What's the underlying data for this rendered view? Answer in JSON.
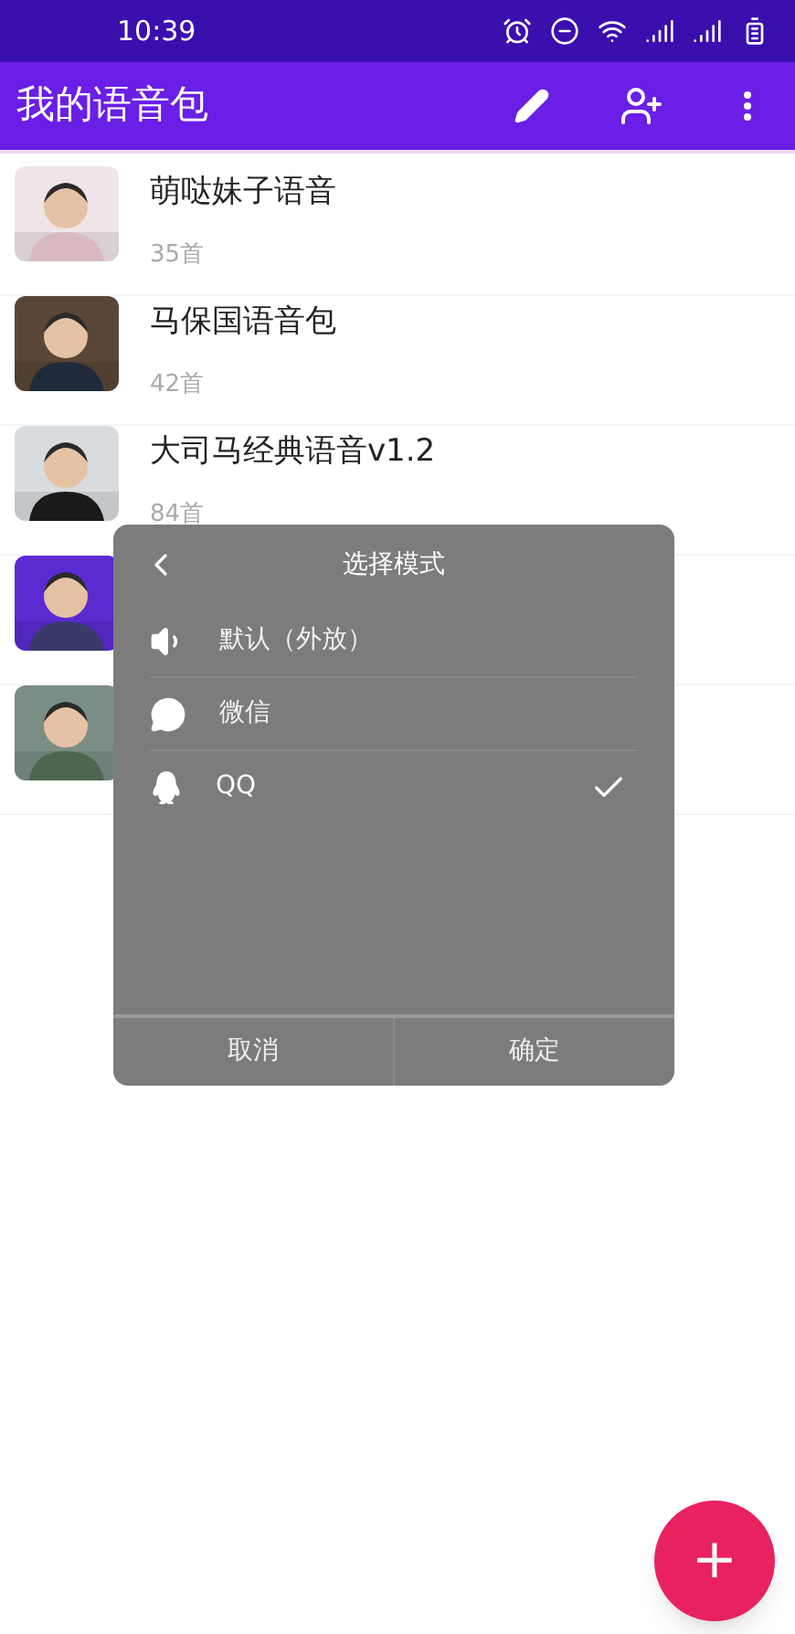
{
  "status_bar": {
    "time": "10:39"
  },
  "app_bar": {
    "title": "我的语音包"
  },
  "voice_packs": [
    {
      "kind": "full",
      "title": "萌哒妹子语音",
      "count": "35首"
    },
    {
      "kind": "full",
      "title": "马保国语音包",
      "count": "42首"
    },
    {
      "kind": "full",
      "title": "大司马经典语音v1.2",
      "count": "84首"
    },
    {
      "kind": "covered"
    },
    {
      "kind": "covered"
    }
  ],
  "dialog": {
    "title": "选择模式",
    "options": [
      {
        "kind": "speaker",
        "label": "默认（外放）",
        "selected": false
      },
      {
        "kind": "wechat",
        "label": "微信",
        "selected": false
      },
      {
        "kind": "qq",
        "label": "QQ",
        "selected": true
      }
    ],
    "buttons": [
      "取消",
      "确定"
    ]
  },
  "fab": {
    "label": "+"
  }
}
